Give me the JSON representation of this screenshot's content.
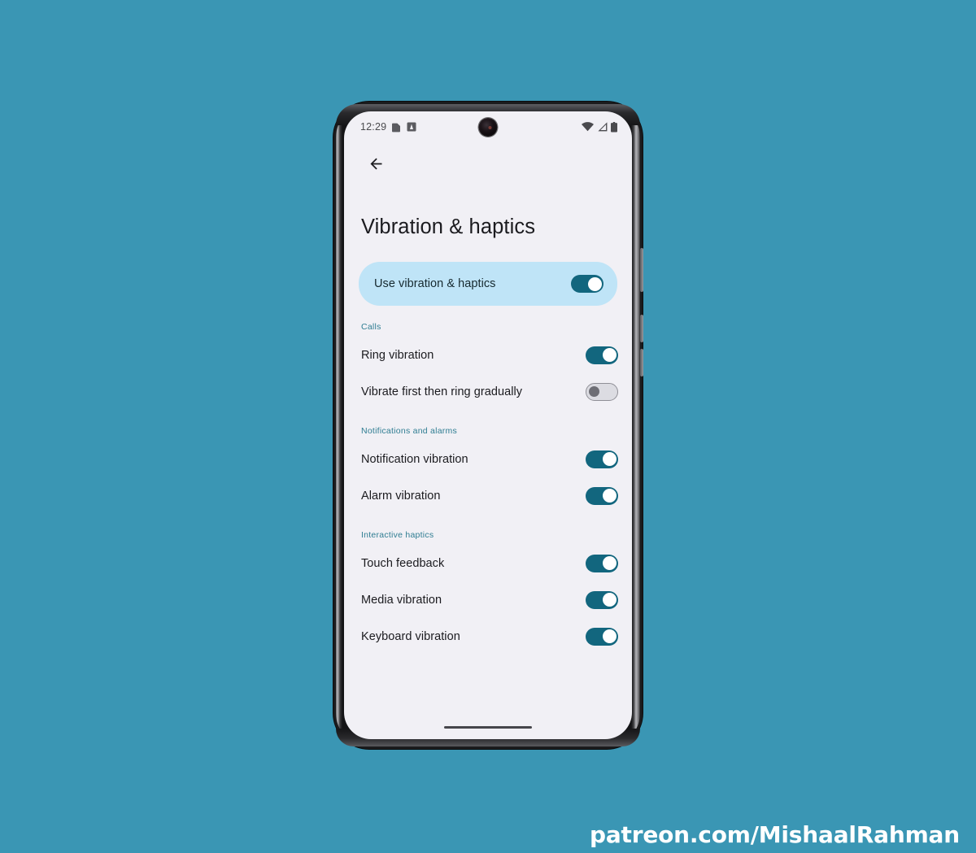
{
  "canvas": {
    "background_color": "#3a96b4"
  },
  "watermark": {
    "text": "patreon.com/MishaalRahman"
  },
  "phone": {
    "status_bar": {
      "time": "12:29",
      "left_icons": [
        "sim-card-icon",
        "app-notification-icon"
      ],
      "right_icons": [
        "wifi-icon",
        "cellular-signal-icon",
        "battery-icon"
      ]
    },
    "camera": "front-camera-punch-hole",
    "gesture_bar": "home-gesture-indicator"
  },
  "screen": {
    "background_color": "#f1f0f5",
    "accent_color": "#12667e",
    "highlight_color": "#bfe4f7",
    "section_header_color": "#2f7d92",
    "back_button": {
      "icon": "back-arrow-icon",
      "label": "Back"
    },
    "title": "Vibration & haptics",
    "master_toggle": {
      "label": "Use vibration & haptics",
      "state": "on"
    },
    "sections": [
      {
        "header": "Calls",
        "rows": [
          {
            "label": "Ring vibration",
            "state": "on"
          },
          {
            "label": "Vibrate first then ring gradually",
            "state": "off"
          }
        ]
      },
      {
        "header": "Notifications and alarms",
        "rows": [
          {
            "label": "Notification vibration",
            "state": "on"
          },
          {
            "label": "Alarm vibration",
            "state": "on"
          }
        ]
      },
      {
        "header": "Interactive haptics",
        "rows": [
          {
            "label": "Touch feedback",
            "state": "on"
          },
          {
            "label": "Media vibration",
            "state": "on"
          },
          {
            "label": "Keyboard vibration",
            "state": "on"
          }
        ]
      }
    ]
  }
}
